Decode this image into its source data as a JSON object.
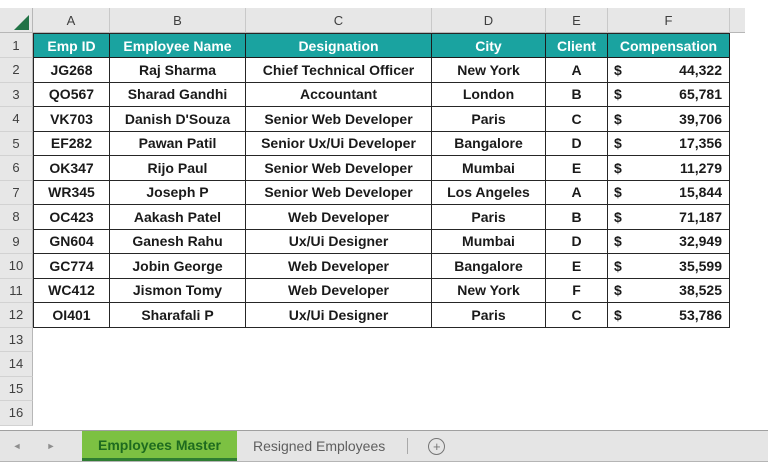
{
  "colors": {
    "header_teal": "#1AA3A0",
    "active_tab_green": "#7CC142",
    "active_tab_text": "#1E6B1F",
    "select_all_green": "#217346"
  },
  "spreadsheet": {
    "column_letters": [
      "A",
      "B",
      "C",
      "D",
      "E",
      "F"
    ],
    "row_numbers": [
      1,
      2,
      3,
      4,
      5,
      6,
      7,
      8,
      9,
      10,
      11,
      12,
      13,
      14,
      15,
      16
    ],
    "table": {
      "headers": [
        "Emp ID",
        "Employee Name",
        "Designation",
        "City",
        "Client",
        "Compensation"
      ],
      "currency_symbol": "$",
      "rows": [
        {
          "emp_id": "JG268",
          "name": "Raj Sharma",
          "designation": "Chief Technical Officer",
          "city": "New York",
          "client": "A",
          "compensation": "44,322"
        },
        {
          "emp_id": "QO567",
          "name": "Sharad Gandhi",
          "designation": "Accountant",
          "city": "London",
          "client": "B",
          "compensation": "65,781"
        },
        {
          "emp_id": "VK703",
          "name": "Danish D'Souza",
          "designation": "Senior Web Developer",
          "city": "Paris",
          "client": "C",
          "compensation": "39,706"
        },
        {
          "emp_id": "EF282",
          "name": "Pawan Patil",
          "designation": "Senior Ux/Ui Developer",
          "city": "Bangalore",
          "client": "D",
          "compensation": "17,356"
        },
        {
          "emp_id": "OK347",
          "name": "Rijo Paul",
          "designation": "Senior Web Developer",
          "city": "Mumbai",
          "client": "E",
          "compensation": "11,279"
        },
        {
          "emp_id": "WR345",
          "name": "Joseph P",
          "designation": "Senior Web Developer",
          "city": "Los Angeles",
          "client": "A",
          "compensation": "15,844"
        },
        {
          "emp_id": "OC423",
          "name": "Aakash Patel",
          "designation": "Web Developer",
          "city": "Paris",
          "client": "B",
          "compensation": "71,187"
        },
        {
          "emp_id": "GN604",
          "name": "Ganesh Rahu",
          "designation": "Ux/Ui Designer",
          "city": "Mumbai",
          "client": "D",
          "compensation": "32,949"
        },
        {
          "emp_id": "GC774",
          "name": "Jobin George",
          "designation": "Web Developer",
          "city": "Bangalore",
          "client": "E",
          "compensation": "35,599"
        },
        {
          "emp_id": "WC412",
          "name": "Jismon Tomy",
          "designation": "Web Developer",
          "city": "New York",
          "client": "F",
          "compensation": "38,525"
        },
        {
          "emp_id": "OI401",
          "name": "Sharafali P",
          "designation": "Ux/Ui Designer",
          "city": "Paris",
          "client": "C",
          "compensation": "53,786"
        }
      ]
    }
  },
  "tab_bar": {
    "active_tab": "Employees Master",
    "inactive_tab": "Resigned Employees",
    "add_sheet_label": "+"
  },
  "icons": {
    "nav_left": "◄",
    "nav_right": "►"
  }
}
